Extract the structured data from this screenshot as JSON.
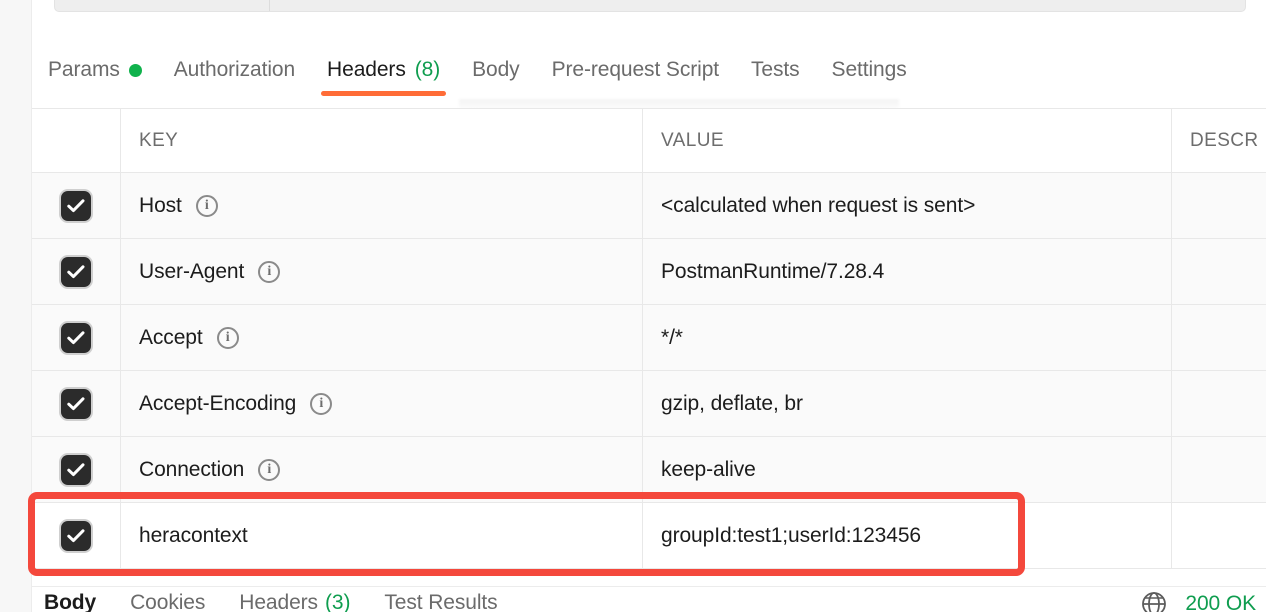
{
  "request": {
    "tabs": [
      {
        "label": "Params",
        "badge_dot": true,
        "count": "",
        "active": false
      },
      {
        "label": "Authorization",
        "badge_dot": false,
        "count": "",
        "active": false
      },
      {
        "label": "Headers",
        "badge_dot": false,
        "count": "(8)",
        "active": true
      },
      {
        "label": "Body",
        "badge_dot": false,
        "count": "",
        "active": false
      },
      {
        "label": "Pre-request Script",
        "badge_dot": false,
        "count": "",
        "active": false
      },
      {
        "label": "Tests",
        "badge_dot": false,
        "count": "",
        "active": false
      },
      {
        "label": "Settings",
        "badge_dot": false,
        "count": "",
        "active": false
      }
    ]
  },
  "headers_table": {
    "columns": [
      "",
      "KEY",
      "VALUE",
      "DESCR"
    ],
    "rows": [
      {
        "checked": true,
        "key": "Host",
        "info": true,
        "value": "<calculated when request is sent>",
        "description": "",
        "highlighted": false
      },
      {
        "checked": true,
        "key": "User-Agent",
        "info": true,
        "value": "PostmanRuntime/7.28.4",
        "description": "",
        "highlighted": false
      },
      {
        "checked": true,
        "key": "Accept",
        "info": true,
        "value": "*/*",
        "description": "",
        "highlighted": false
      },
      {
        "checked": true,
        "key": "Accept-Encoding",
        "info": true,
        "value": "gzip, deflate, br",
        "description": "",
        "highlighted": false
      },
      {
        "checked": true,
        "key": "Connection",
        "info": true,
        "value": "keep-alive",
        "description": "",
        "highlighted": false
      },
      {
        "checked": true,
        "key": "heracontext",
        "info": false,
        "value": "groupId:test1;userId:123456",
        "description": "",
        "highlighted": true
      }
    ]
  },
  "response": {
    "tabs": [
      {
        "label": "Body",
        "count": "",
        "active": true
      },
      {
        "label": "Cookies",
        "count": "",
        "active": false
      },
      {
        "label": "Headers",
        "count": "(3)",
        "active": false
      },
      {
        "label": "Test Results",
        "count": "",
        "active": false
      }
    ],
    "status": "200 OK"
  },
  "colors": {
    "accent_orange": "#ff6c37",
    "success_green": "#0f9d4f",
    "dot_green": "#10b24c",
    "annotation_red": "#f4483c",
    "text_primary": "#1c1c1c",
    "text_secondary": "#6b6b6b"
  }
}
